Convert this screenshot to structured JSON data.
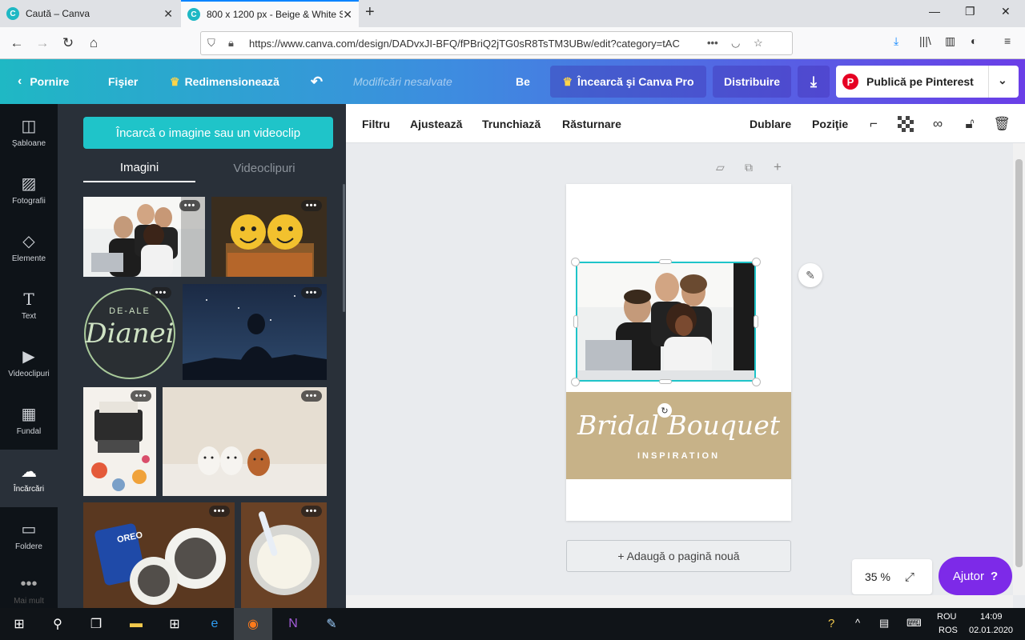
{
  "browser": {
    "tabs": [
      {
        "title": "Caută – Canva"
      },
      {
        "title": "800 x 1200 px - Beige & White S"
      }
    ],
    "url": "https://www.canva.com/design/DADvxJI-BFQ/fPBriQ2jTG0sR8TsTM3UBw/edit?category=tAC"
  },
  "header": {
    "home": "Pornire",
    "file": "Fişier",
    "resize": "Redimensionează",
    "unsaved": "Modificări nesalvate",
    "be": "Be",
    "try_pro": "Încearcă şi Canva Pro",
    "share": "Distribuire",
    "publish": "Publică pe Pinterest"
  },
  "rail": {
    "items": [
      {
        "label": "Şabloane",
        "icon": "templates-icon"
      },
      {
        "label": "Fotografii",
        "icon": "photos-icon"
      },
      {
        "label": "Elemente",
        "icon": "elements-icon"
      },
      {
        "label": "Text",
        "icon": "text-icon"
      },
      {
        "label": "Videoclipuri",
        "icon": "video-icon"
      },
      {
        "label": "Fundal",
        "icon": "background-icon"
      },
      {
        "label": "Încărcări",
        "icon": "upload-icon"
      },
      {
        "label": "Foldere",
        "icon": "folder-icon"
      },
      {
        "label": "Mai mult",
        "icon": "more-icon"
      }
    ]
  },
  "panel": {
    "upload_button": "Încarcă o imagine sau un videoclip",
    "tabs": [
      "Imagini",
      "Videoclipuri"
    ],
    "logo_small": "DE-ALE",
    "logo_big": "Dianei"
  },
  "toolbar": {
    "filter": "Filtru",
    "adjust": "Ajustează",
    "crop": "Trunchiază",
    "flip": "Răsturnare",
    "duplicate": "Dublare",
    "position": "Poziţie"
  },
  "canvas": {
    "title": "Bridal Bouquet",
    "subtitle": "INSPIRATION",
    "add_page": "+ Adaugă o pagină nouă",
    "zoom": "35 %",
    "help": "Ajutor",
    "help_glyph": "?"
  },
  "taskbar": {
    "lang_top": "ROU",
    "lang_bottom": "ROS",
    "time": "14:09",
    "date": "02.01.2020"
  },
  "colors": {
    "teal": "#1fc4c9",
    "purple": "#7d2ae8",
    "banner": "#c7b288",
    "panel": "#293039"
  }
}
